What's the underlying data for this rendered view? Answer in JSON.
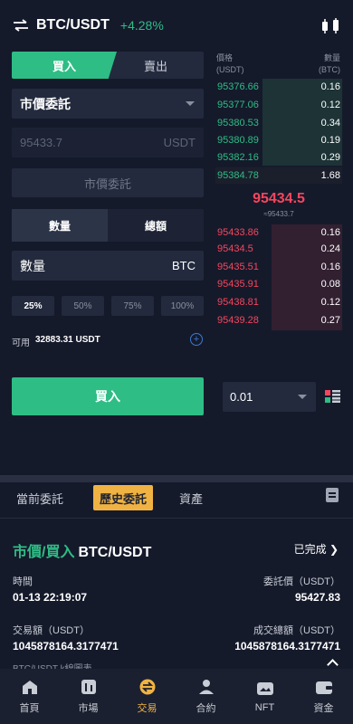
{
  "header": {
    "pair": "BTC/USDT",
    "change": "+4.28%"
  },
  "trade": {
    "tabs": {
      "buy": "買入",
      "sell": "賣出"
    },
    "order_type": "市價委託",
    "price_placeholder": "95433.7",
    "price_unit": "USDT",
    "market_button": "市價委託",
    "mode_tabs": {
      "quantity": "數量",
      "total": "總額"
    },
    "amount_label": "數量",
    "amount_unit": "BTC",
    "percentages": [
      "25%",
      "50%",
      "75%",
      "100%"
    ],
    "available_label": "可用",
    "available_value": "32883.31 USDT",
    "buy_button": "買入",
    "depth_value": "0.01"
  },
  "orderbook": {
    "price_header": "價格",
    "price_unit": "(USDT)",
    "qty_header": "數量",
    "qty_unit": "(BTC)",
    "bids": [
      {
        "price": "95376.66",
        "qty": "0.16"
      },
      {
        "price": "95377.06",
        "qty": "0.12"
      },
      {
        "price": "95380.53",
        "qty": "0.34"
      },
      {
        "price": "95380.89",
        "qty": "0.19"
      },
      {
        "price": "95382.16",
        "qty": "0.29"
      },
      {
        "price": "95384.78",
        "qty": "1.68"
      }
    ],
    "last_price": "95434.5",
    "last_sub": "≈95433.7",
    "asks": [
      {
        "price": "95433.86",
        "qty": "0.16"
      },
      {
        "price": "95434.5",
        "qty": "0.24"
      },
      {
        "price": "95435.51",
        "qty": "0.16"
      },
      {
        "price": "95435.91",
        "qty": "0.08"
      },
      {
        "price": "95438.81",
        "qty": "0.12"
      },
      {
        "price": "95439.28",
        "qty": "0.27"
      }
    ]
  },
  "orders": {
    "tabs": [
      "當前委託",
      "歷史委託",
      "資產"
    ],
    "title_type": "市價/買入",
    "title_pair": "BTC/USDT",
    "status": "已完成 ❯",
    "time_label": "時間",
    "time_value": "01-13 22:19:07",
    "order_price_label": "委託價（USDT）",
    "order_price_value": "95427.83",
    "amount_label": "交易額（USDT）",
    "amount_value": "1045878164.3177471",
    "filled_label": "成交總額（USDT）",
    "filled_value": "1045878164.3177471",
    "cut_text": "BTC/USDT k線圖表"
  },
  "nav": [
    "首頁",
    "市場",
    "交易",
    "合約",
    "NFT",
    "資金"
  ],
  "colors": {
    "green": "#2ebd85",
    "red": "#f6465d",
    "accent": "#f0b343",
    "bg": "#151a2b"
  }
}
